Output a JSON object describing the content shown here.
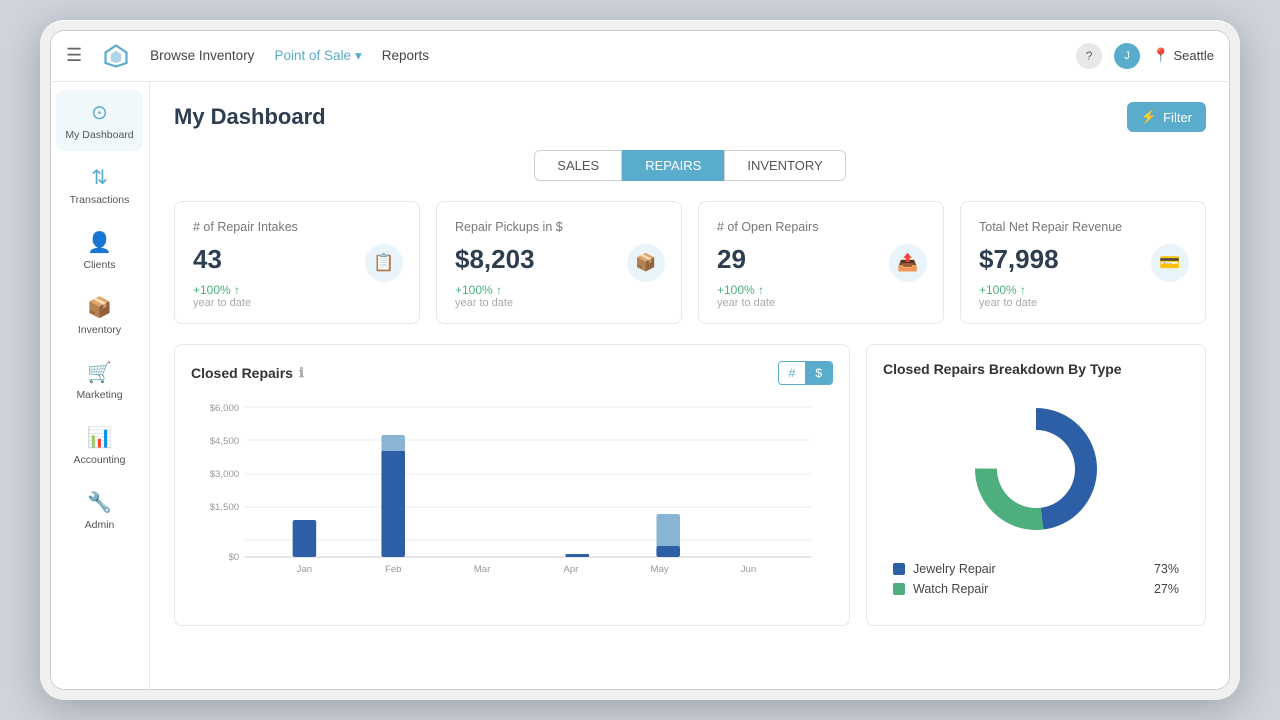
{
  "nav": {
    "menu_icon": "☰",
    "browse_inventory": "Browse Inventory",
    "point_of_sale": "Point of Sale",
    "reports": "Reports",
    "help": "?",
    "avatar": "J",
    "location": "Seattle"
  },
  "sidebar": {
    "items": [
      {
        "label": "My Dashboard",
        "icon": "⊙",
        "active": true
      },
      {
        "label": "Transactions",
        "icon": "↕"
      },
      {
        "label": "Clients",
        "icon": "👤"
      },
      {
        "label": "Inventory",
        "icon": "📦"
      },
      {
        "label": "Marketing",
        "icon": "🛒"
      },
      {
        "label": "Accounting",
        "icon": "📊"
      },
      {
        "label": "Admin",
        "icon": "🔧"
      }
    ]
  },
  "page": {
    "title": "My Dashboard",
    "filter_btn": "Filter"
  },
  "tabs": [
    {
      "label": "SALES",
      "active": false
    },
    {
      "label": "REPAIRS",
      "active": true
    },
    {
      "label": "INVENTORY",
      "active": false
    }
  ],
  "metrics": [
    {
      "title": "# of Repair Intakes",
      "value": "43",
      "change": "+100% ↑",
      "sub": "year to date",
      "icon": "📋"
    },
    {
      "title": "Repair Pickups in $",
      "value": "$8,203",
      "change": "+100% ↑",
      "sub": "year to date",
      "icon": "📦"
    },
    {
      "title": "# of Open Repairs",
      "value": "29",
      "change": "+100% ↑",
      "sub": "year to date",
      "icon": "📤"
    },
    {
      "title": "Total Net Repair Revenue",
      "value": "$7,998",
      "change": "+100% ↑",
      "sub": "year to date",
      "icon": "💳"
    }
  ],
  "closed_repairs_chart": {
    "title": "Closed Repairs",
    "toggle": [
      "#",
      "$"
    ],
    "active_toggle": "$",
    "yLabels": [
      "$6,000",
      "$4,500",
      "$3,000",
      "$1,500",
      "$0"
    ],
    "xLabels": [
      "Jan",
      "Feb",
      "Mar",
      "Apr",
      "May",
      "Jun"
    ],
    "bars": [
      {
        "month": "Jan",
        "completed": 1400,
        "pending": 0
      },
      {
        "month": "Feb",
        "completed": 4000,
        "pending": 4600
      },
      {
        "month": "Mar",
        "completed": 0,
        "pending": 0
      },
      {
        "month": "Apr",
        "completed": 120,
        "pending": 0
      },
      {
        "month": "May",
        "completed": 400,
        "pending": 1800
      },
      {
        "month": "Jun",
        "completed": 0,
        "pending": 0
      }
    ],
    "max": 6000
  },
  "breakdown_chart": {
    "title": "Closed Repairs Breakdown By Type",
    "segments": [
      {
        "label": "Jewelry Repair",
        "pct": 73,
        "color": "#2d5fa6"
      },
      {
        "label": "Watch Repair",
        "pct": 27,
        "color": "#4caf7d"
      }
    ]
  }
}
